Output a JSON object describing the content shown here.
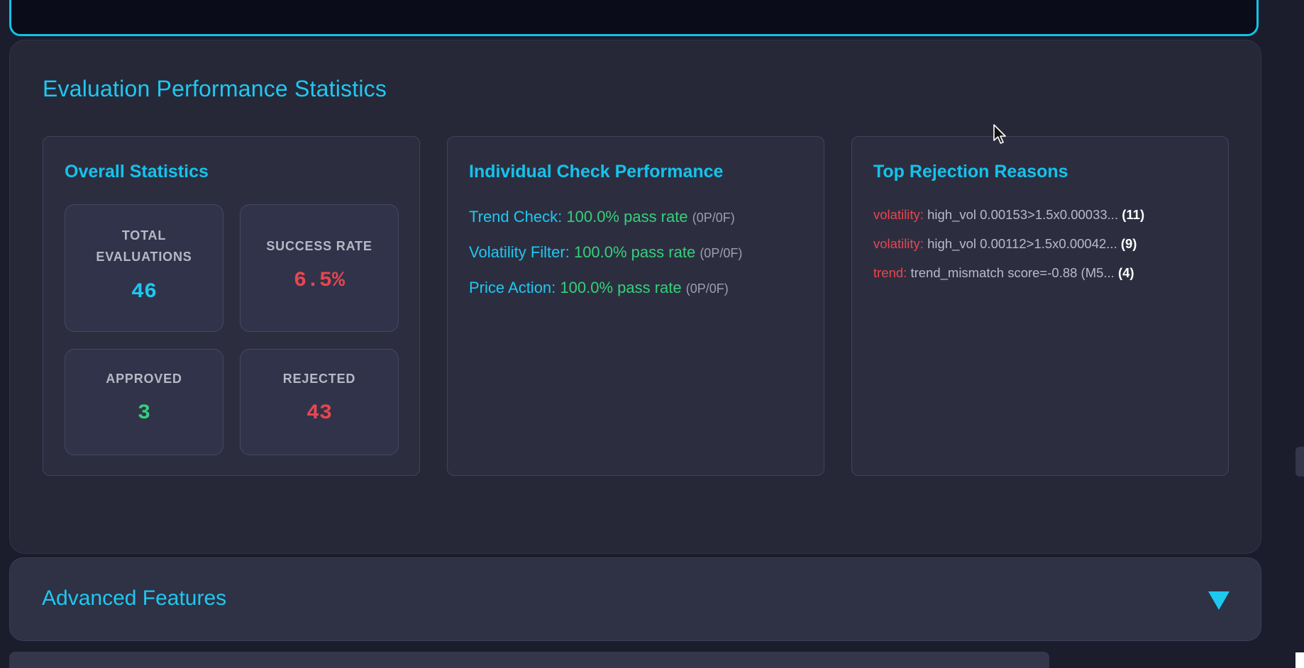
{
  "stats": {
    "title": "Evaluation Performance Statistics",
    "overall": {
      "title": "Overall Statistics",
      "total_label": "TOTAL EVALUATIONS",
      "total_value": "46",
      "success_label": "SUCCESS RATE",
      "success_value": "6.5%",
      "approved_label": "APPROVED",
      "approved_value": "3",
      "rejected_label": "REJECTED",
      "rejected_value": "43"
    },
    "checks": {
      "title": "Individual Check Performance",
      "items": [
        {
          "name": "Trend Check:",
          "rate": "100.0% pass rate",
          "counts": "(0P/0F)"
        },
        {
          "name": "Volatility Filter:",
          "rate": "100.0% pass rate",
          "counts": "(0P/0F)"
        },
        {
          "name": "Price Action:",
          "rate": "100.0% pass rate",
          "counts": "(0P/0F)"
        }
      ]
    },
    "rejections": {
      "title": "Top Rejection Reasons",
      "items": [
        {
          "category": "volatility:",
          "text": "high_vol 0.00153>1.5x0.00033...",
          "count": "(11)"
        },
        {
          "category": "volatility:",
          "text": "high_vol 0.00112>1.5x0.00042...",
          "count": "(9)"
        },
        {
          "category": "trend:",
          "text": "trend_mismatch score=-0.88 (M5...",
          "count": "(4)"
        }
      ]
    }
  },
  "advanced": {
    "title": "Advanced Features",
    "toggle_icon": "triangle-down-icon"
  },
  "colors": {
    "accent": "#1ec8f0",
    "success": "#35d07a",
    "danger": "#e8464e",
    "background": "#1b1c2c",
    "panel": "#262838"
  }
}
